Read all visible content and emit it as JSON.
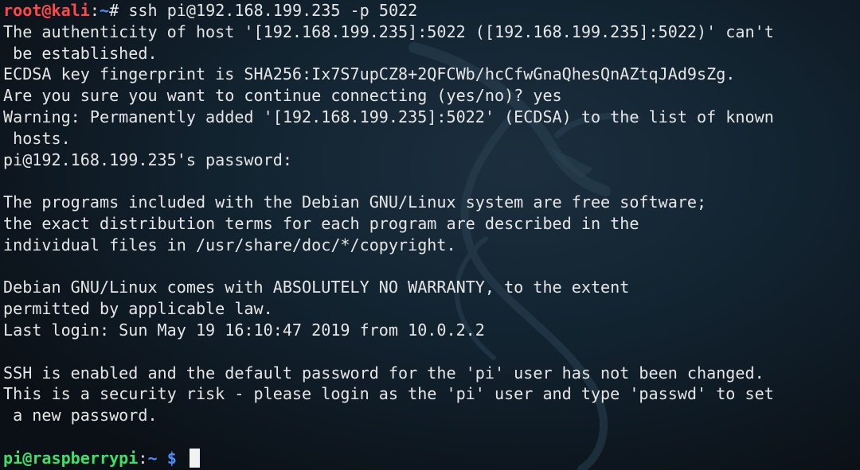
{
  "terminal": {
    "prompt1": {
      "user_host": "root@kali",
      "sep": ":",
      "path": "~",
      "symbol": "# ",
      "command": "ssh pi@192.168.199.235 -p 5022"
    },
    "output": [
      "The authenticity of host '[192.168.199.235]:5022 ([192.168.199.235]:5022)' can't",
      " be established.",
      "ECDSA key fingerprint is SHA256:Ix7S7upCZ8+2QFCWb/hcCfwGnaQhesQnAZtqJAd9sZg.",
      "Are you sure you want to continue connecting (yes/no)? yes",
      "Warning: Permanently added '[192.168.199.235]:5022' (ECDSA) to the list of known",
      " hosts.",
      "pi@192.168.199.235's password:",
      "",
      "The programs included with the Debian GNU/Linux system are free software;",
      "the exact distribution terms for each program are described in the",
      "individual files in /usr/share/doc/*/copyright.",
      "",
      "Debian GNU/Linux comes with ABSOLUTELY NO WARRANTY, to the extent",
      "permitted by applicable law.",
      "Last login: Sun May 19 16:10:47 2019 from 10.0.2.2",
      "",
      "SSH is enabled and the default password for the 'pi' user has not been changed.",
      "This is a security risk - please login as the 'pi' user and type 'passwd' to set",
      " a new password.",
      ""
    ],
    "prompt2": {
      "user_host": "pi@raspberrypi",
      "sep": ":",
      "path": "~ ",
      "symbol": "$ "
    },
    "colors": {
      "root_prompt": "#ff4848",
      "path": "#4d8eff",
      "pi_prompt": "#3ee06a",
      "text": "#e6e6e6",
      "background": "#0b1016"
    },
    "background_logo": "kali-dragon"
  }
}
